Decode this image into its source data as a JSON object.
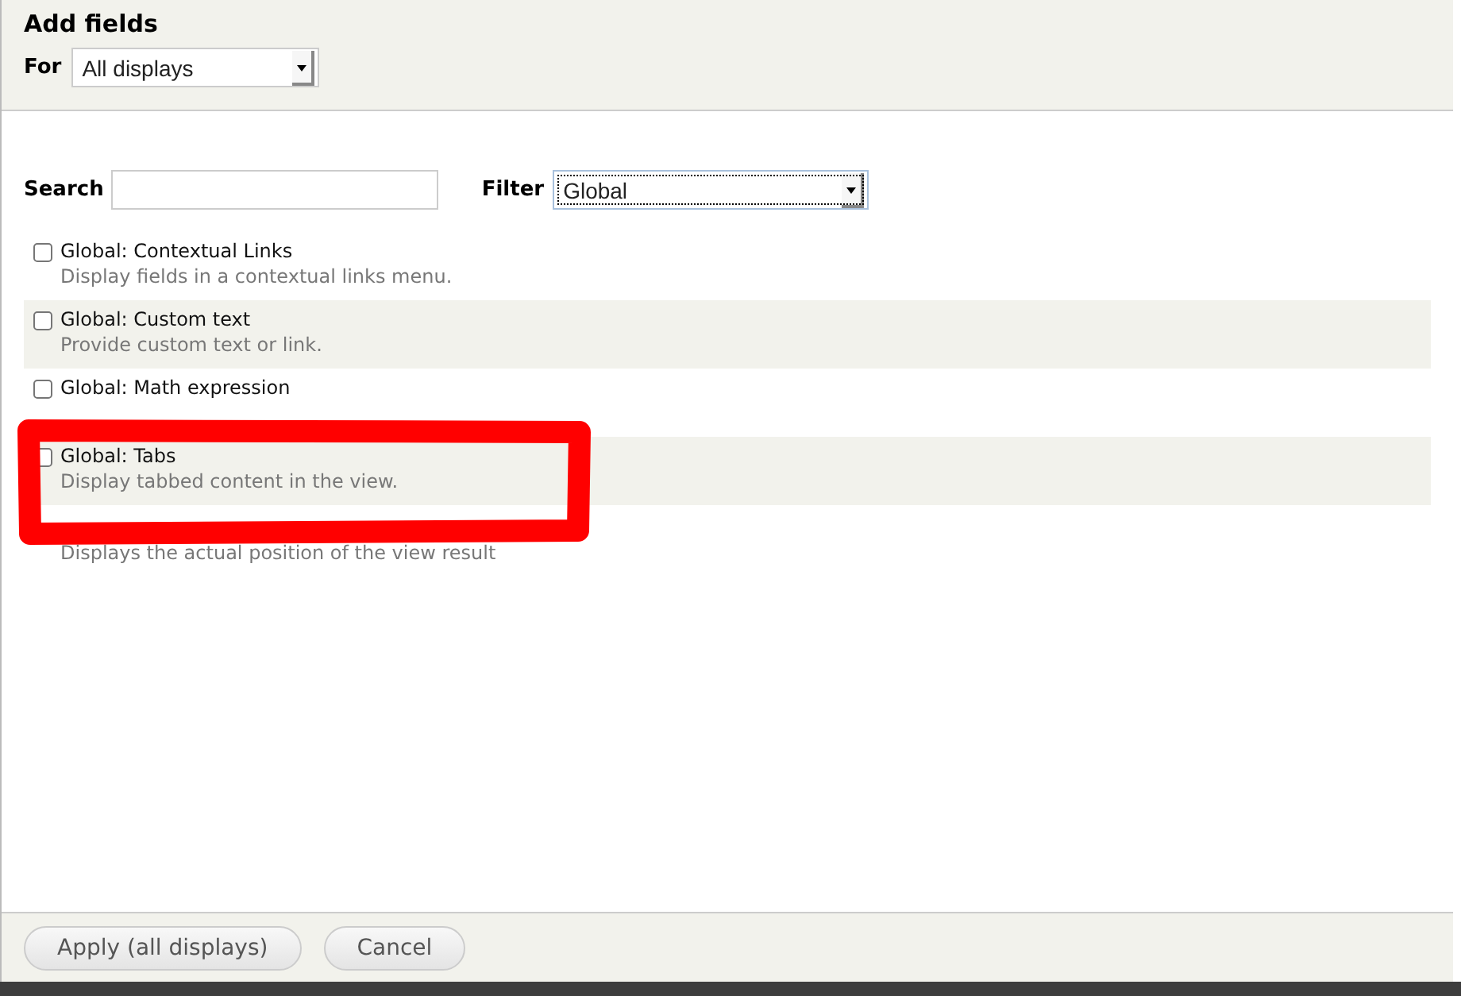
{
  "dialog": {
    "title": "Add fields",
    "for_label": "For",
    "for_value": "All displays"
  },
  "search": {
    "label": "Search"
  },
  "filter": {
    "label": "Filter",
    "value": "Global"
  },
  "fields": [
    {
      "title": "Global: Contextual Links",
      "description": "Display fields in a contextual links menu.",
      "checked": false
    },
    {
      "title": "Global: Custom text",
      "description": "Provide custom text or link.",
      "checked": false
    },
    {
      "title": "Global: Math expression",
      "checked": false
    },
    {
      "title": "Global: Tabs",
      "description": "Display tabbed content in the view.",
      "checked": false
    },
    {
      "description": "Displays the actual position of the view result"
    }
  ],
  "buttons": [
    {
      "label": "Apply (all displays)"
    },
    {
      "label": "Cancel"
    }
  ]
}
